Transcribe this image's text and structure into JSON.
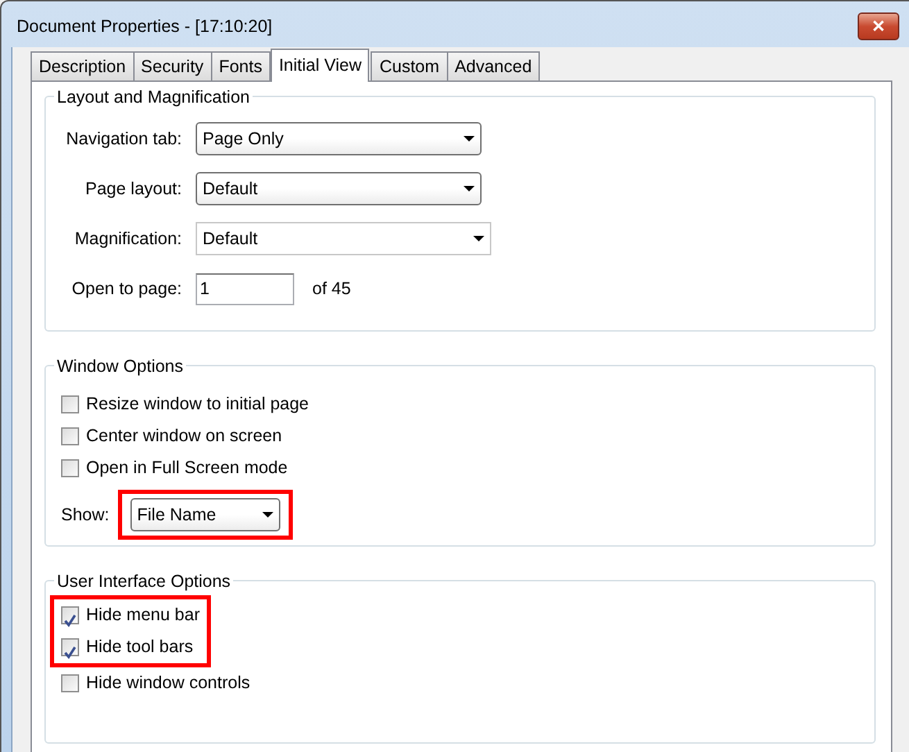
{
  "window": {
    "title": "Document Properties - [17:10:20]",
    "close": "✕"
  },
  "tabs": [
    {
      "label": "Description",
      "selected": false
    },
    {
      "label": "Security",
      "selected": false
    },
    {
      "label": "Fonts",
      "selected": false
    },
    {
      "label": "Initial View",
      "selected": true
    },
    {
      "label": "Custom",
      "selected": false
    },
    {
      "label": "Advanced",
      "selected": false
    }
  ],
  "layout_group": {
    "title": "Layout and Magnification",
    "fields": [
      {
        "label": "Navigation tab:",
        "kind": "dropdown",
        "value": "Page Only"
      },
      {
        "label": "Page layout:",
        "kind": "dropdown",
        "value": "Default"
      },
      {
        "label": "Magnification:",
        "kind": "combo",
        "value": "Default"
      },
      {
        "label": "Open to page:",
        "kind": "text",
        "value": "1",
        "suffix": "of 45"
      }
    ]
  },
  "window_group": {
    "title": "Window Options",
    "options": [
      {
        "label": "Resize window to initial page",
        "checked": false,
        "highlighted": false
      },
      {
        "label": "Center window on screen",
        "checked": false,
        "highlighted": false
      },
      {
        "label": "Open in Full Screen mode",
        "checked": false,
        "highlighted": false
      }
    ],
    "show": {
      "label": "Show:",
      "value": "File Name",
      "highlighted": true
    }
  },
  "ui_group": {
    "title": "User Interface Options",
    "options": [
      {
        "label": "Hide menu bar",
        "checked": true,
        "highlighted": true
      },
      {
        "label": "Hide tool bars",
        "checked": true,
        "highlighted": true
      },
      {
        "label": "Hide window controls",
        "checked": false,
        "highlighted": false
      }
    ]
  }
}
